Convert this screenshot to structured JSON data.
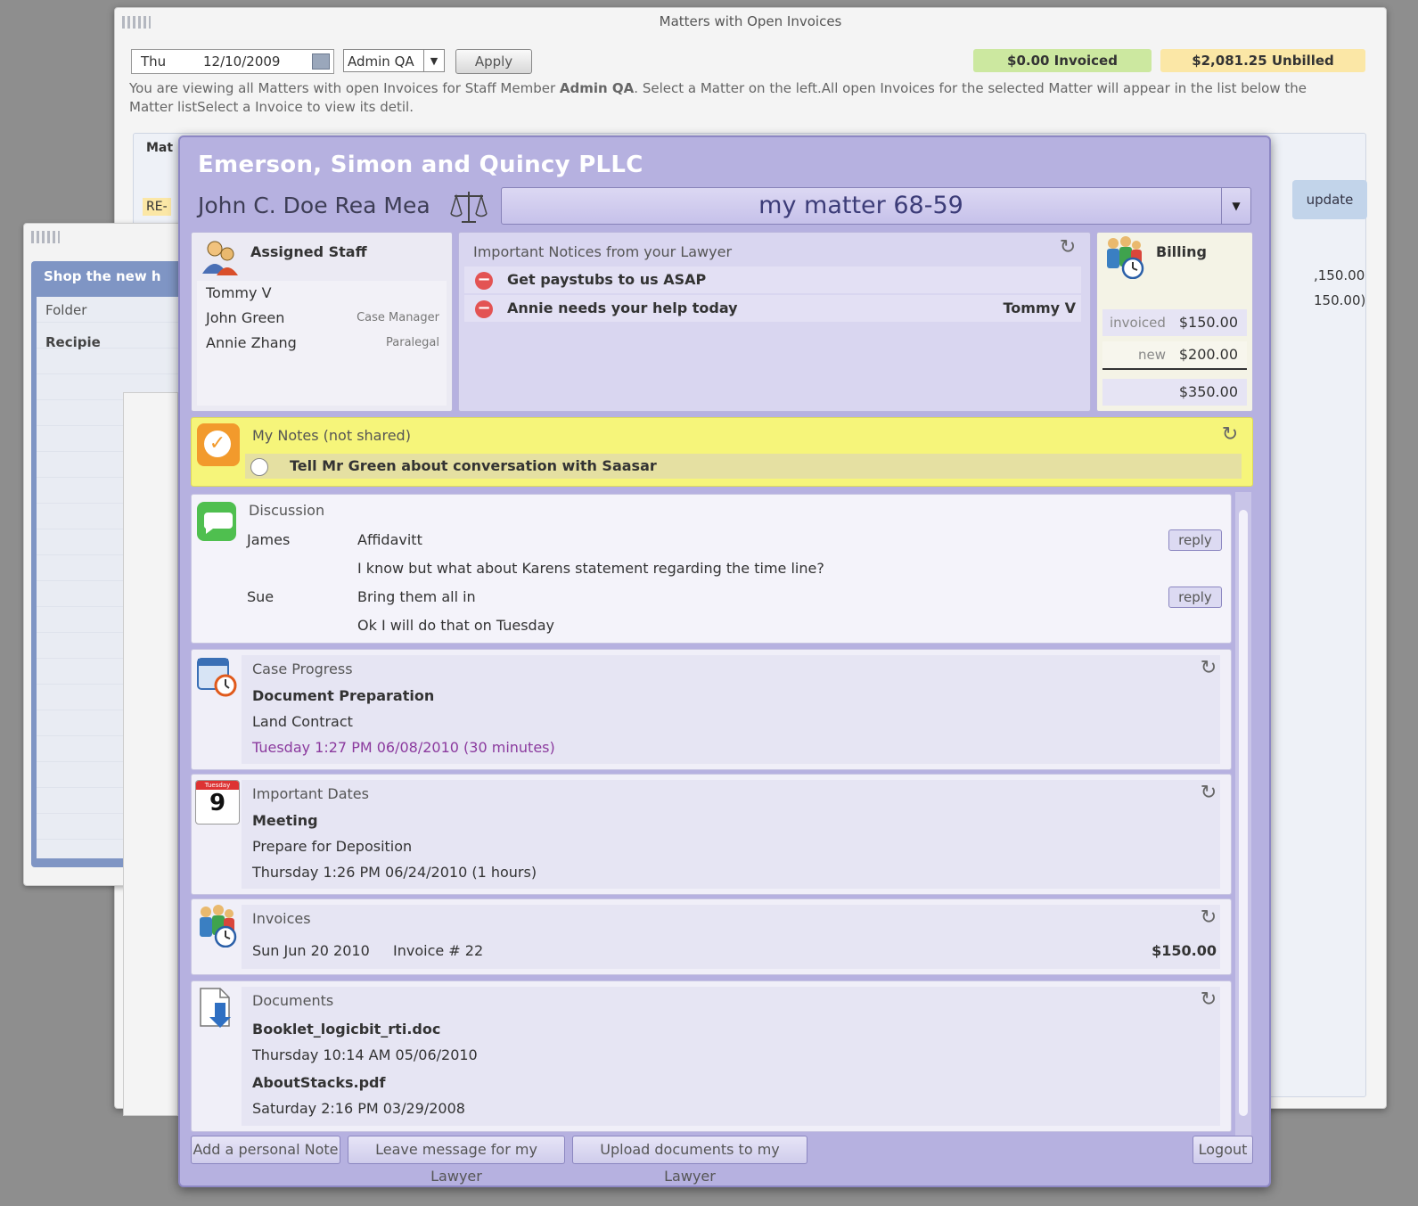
{
  "bg_window": {
    "title": "Matters with Open Invoices",
    "day": "Thu",
    "date": "12/10/2009",
    "staff_select": "Admin QA",
    "apply_label": "Apply",
    "invoiced_badge": "$0.00 Invoiced",
    "unbilled_badge": "$2,081.25 Unbilled",
    "info_prefix": "You are viewing all Matters with open Invoices for Staff Member ",
    "info_staff": "Admin QA",
    "info_suffix": ". Select a Matter on the left.All open Invoices for the selected Matter will appear in the list below the Matter listSelect a Invoice to view its detil.",
    "update_label": "update",
    "re_label": "RE-",
    "mat_label": "Mat",
    "amount1": ",150.00",
    "amount2": "150.00)"
  },
  "bg_window2": {
    "shop": "Shop the new h",
    "folder": "Folder",
    "recipients": "Recipie"
  },
  "portal": {
    "firm": "Emerson, Simon and Quincy PLLC",
    "client": "John C. Doe Rea Mea",
    "matter": "my matter 68-59",
    "staff": {
      "title": "Assigned Staff",
      "members": [
        {
          "name": "Tommy V",
          "role": ""
        },
        {
          "name": "John Green",
          "role": "Case Manager"
        },
        {
          "name": "Annie Zhang",
          "role": "Paralegal"
        }
      ]
    },
    "notices": {
      "title": "Important Notices from your Lawyer",
      "items": [
        {
          "text": "Get paystubs to us ASAP",
          "from": ""
        },
        {
          "text": "Annie needs your help today",
          "from": "Tommy V"
        }
      ]
    },
    "billing": {
      "title": "Billing",
      "invoiced_label": "invoiced",
      "invoiced": "$150.00",
      "new_label": "new",
      "new": "$200.00",
      "total": "$350.00"
    },
    "my_notes": {
      "title": "My Notes (not shared)",
      "items": [
        "Tell Mr Green about conversation with Saasar"
      ]
    },
    "discussion": {
      "title": "Discussion",
      "reply_label": "reply",
      "rows": [
        {
          "who": "James",
          "msg": "Affidavitt"
        },
        {
          "who": "",
          "msg": "I know but what about Karens statement regarding the time line?"
        },
        {
          "who": "Sue",
          "msg": "Bring them all in"
        },
        {
          "who": "",
          "msg": "Ok I will do that on Tuesday"
        }
      ]
    },
    "case_progress": {
      "title": "Case Progress",
      "item": "Document Preparation",
      "sub": "Land Contract",
      "when": "Tuesday 1:27 PM  06/08/2010  (30 minutes)"
    },
    "important_dates": {
      "title": "Important Dates",
      "calendar_day": "9",
      "calendar_top": "Tuesday",
      "item": "Meeting",
      "sub": "Prepare for Deposition",
      "when": "Thursday 1:26 PM  06/24/2010  (1 hours)"
    },
    "invoices": {
      "title": "Invoices",
      "date": "Sun Jun 20 2010",
      "number": "Invoice # 22",
      "amount": "$150.00"
    },
    "documents": {
      "title": "Documents",
      "items": [
        {
          "name": "Booklet_logicbit_rti.doc",
          "when": "Thursday 10:14 AM  05/06/2010"
        },
        {
          "name": "AboutStacks.pdf",
          "when": "Saturday 2:16 PM  03/29/2008"
        }
      ]
    },
    "buttons": {
      "add_note": "Add a personal Note",
      "leave_message": "Leave message for my Lawyer",
      "upload": "Upload documents to my Lawyer",
      "logout": "Logout"
    }
  }
}
